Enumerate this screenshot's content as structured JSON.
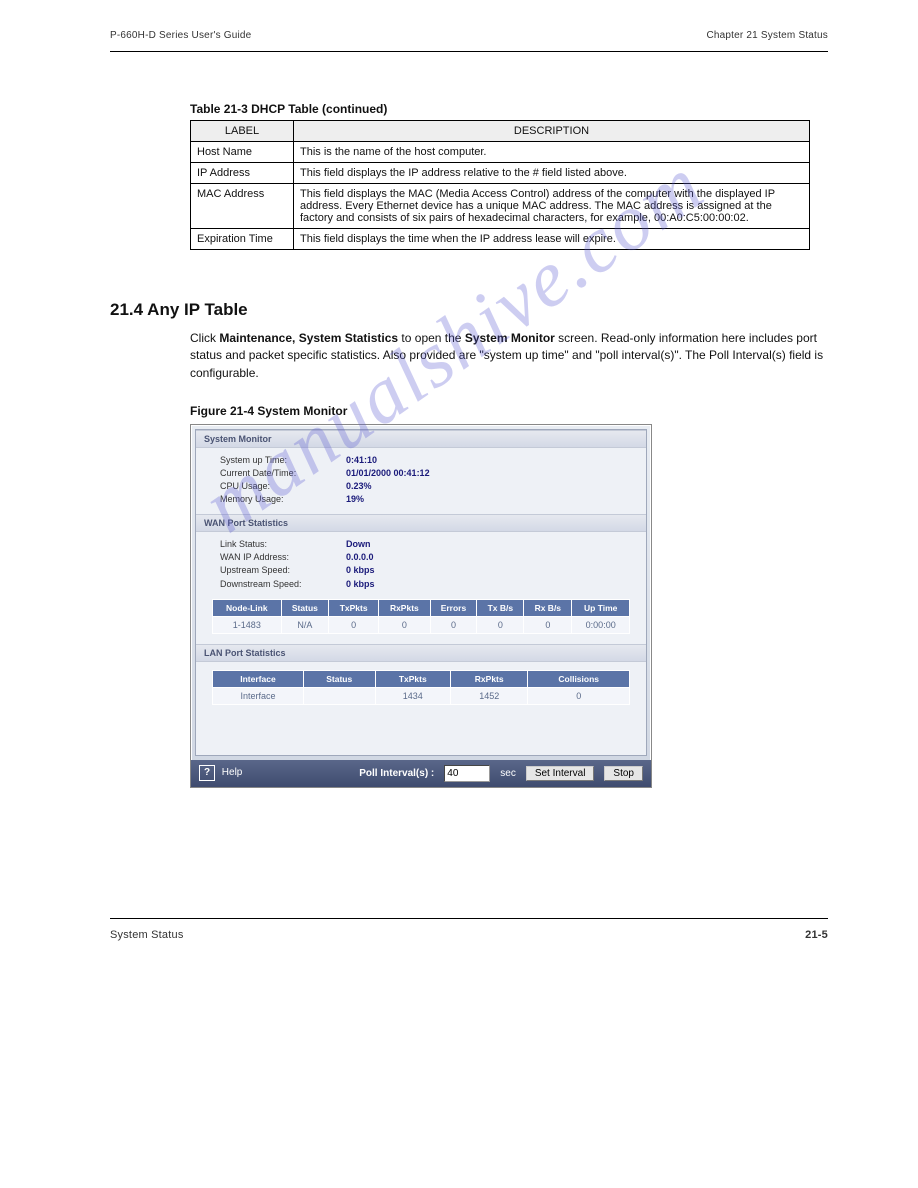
{
  "header": {
    "left": "P-660H-D Series User's Guide",
    "right": "Chapter 21 System Status"
  },
  "table21_3": {
    "caption": "Table 21-3 DHCP Table (continued)",
    "headers": [
      "LABEL",
      "DESCRIPTION"
    ],
    "rows": [
      {
        "label": "Host Name",
        "desc": "This is the name of the host computer."
      },
      {
        "label": "IP Address",
        "desc": "This field displays the IP address relative to the # field listed above."
      },
      {
        "label": "MAC Address",
        "desc": "This field displays the MAC (Media Access Control) address of the computer with the displayed IP address. Every Ethernet device has a unique MAC address. The MAC address is assigned at the factory and consists of six pairs of hexadecimal characters, for example, 00:A0:C5:00:00:02."
      },
      {
        "label": "Expiration Time",
        "desc": "This field displays the time when the IP address lease will expire."
      }
    ]
  },
  "section": {
    "number": "21.4 Any IP Table",
    "body_prefix": "Click ",
    "body_bold1": "Maintenance, System Statistics",
    "body_mid": " to open the ",
    "body_bold2": "System Monitor",
    "body_suffix": " screen. Read-only information here includes port status and packet specific statistics. Also provided are \"system up time\" and \"poll interval(s)\". The Poll Interval(s) field is configurable."
  },
  "figure": {
    "caption": "Figure 21-4 System Monitor"
  },
  "monitor": {
    "section1": "System Monitor",
    "sys_up_time_k": "System up Time:",
    "sys_up_time_v": "0:41:10",
    "datetime_k": "Current Date/Time:",
    "datetime_v": "01/01/2000  00:41:12",
    "cpu_k": "CPU Usage:",
    "cpu_v": "0.23%",
    "mem_k": "Memory Usage:",
    "mem_v": "19%",
    "section2": "WAN Port Statistics",
    "link_k": "Link Status:",
    "link_v": "Down",
    "wanip_k": "WAN IP Address:",
    "wanip_v": "0.0.0.0",
    "up_k": "Upstream Speed:",
    "up_v": "0 kbps",
    "down_k": "Downstream Speed:",
    "down_v": "0 kbps",
    "wan_headers": [
      "Node-Link",
      "Status",
      "TxPkts",
      "RxPkts",
      "Errors",
      "Tx B/s",
      "Rx B/s",
      "Up Time"
    ],
    "wan_row": [
      "1-1483",
      "N/A",
      "0",
      "0",
      "0",
      "0",
      "0",
      "0:00:00"
    ],
    "section3": "LAN Port Statistics",
    "lan_headers": [
      "Interface",
      "Status",
      "TxPkts",
      "RxPkts",
      "Collisions"
    ],
    "lan_row": [
      "Interface",
      "",
      "1434",
      "1452",
      "0"
    ]
  },
  "bottom": {
    "help": "Help",
    "poll_label": "Poll Interval(s) :",
    "poll_value": "40",
    "poll_unit": "sec",
    "set_btn": "Set Interval",
    "stop_btn": "Stop"
  },
  "footer": {
    "left": "System Status",
    "right": "21-5"
  },
  "watermark": "manualshive.com"
}
